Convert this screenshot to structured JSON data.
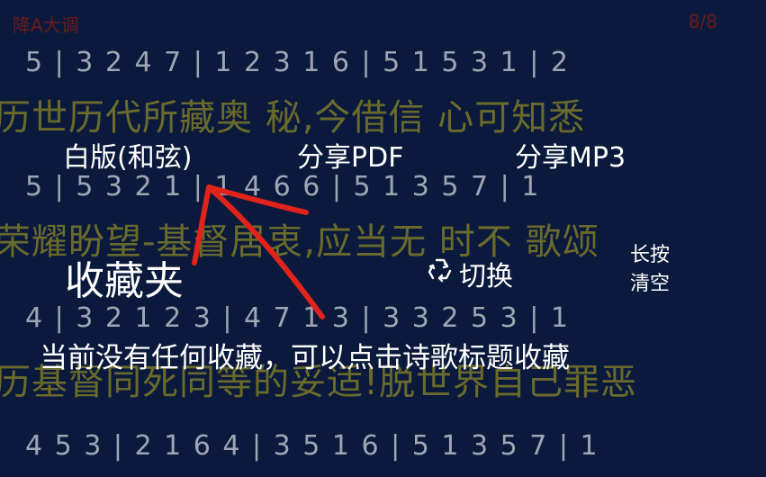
{
  "background": {
    "key_label": "降A大调",
    "page_indicator": "8/8",
    "notation_rows": [
      "5 | 3  2  4  7 | 1 2  3   1  6 | 5 1  5  3  1 | 2",
      "5 | 5  3  2  1 | 1  4  6  6 | 5 1  3   5  7 | 1",
      "4 | 3  2 1 2 3 | 4  7  1  3 | 3  3  2  5  3 | 1",
      "4  5  3 | 2  1  6  4 | 3  5  1  6 | 5 1  3  5  7 | 1"
    ],
    "lyric_rows": [
      "历世历代所藏奥  秘,今借信  心可知悉",
      "荣耀盼望-基督居衷,应当无  时不  歌颂",
      "历基督同死同等的妥适!脱世界自己罪恶"
    ]
  },
  "menu": {
    "white_chord": "白版(和弦)",
    "share_pdf": "分享PDF",
    "share_mp3": "分享MP3",
    "favorites_title": "收藏夹",
    "switch_label": "切换",
    "long_press": "长按",
    "clear": "清空",
    "empty_message": "当前没有任何收藏，可以点击诗歌标题收藏"
  },
  "colors": {
    "background": "#0b1a3c",
    "lyric": "#6a6a2c",
    "annotation_arrow": "#e0241b",
    "header_text": "#6b1a1a"
  },
  "icons": {
    "switch": "recycle-icon"
  }
}
